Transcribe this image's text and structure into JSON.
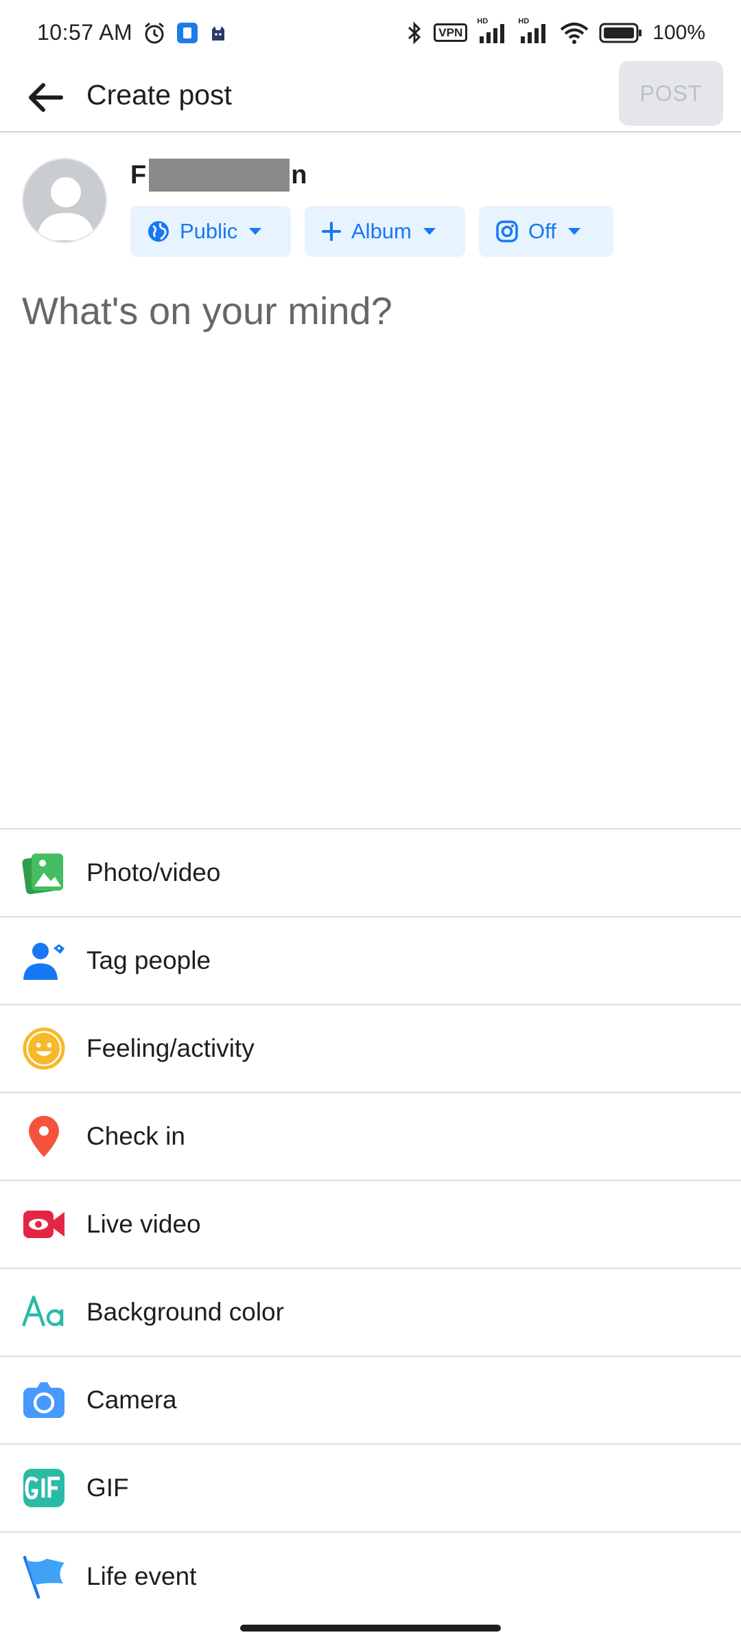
{
  "status_bar": {
    "time": "10:57 AM",
    "vpn": "VPN",
    "hd1": "HD",
    "hd2": "HD",
    "battery_pct": "100%"
  },
  "app_bar": {
    "title": "Create post",
    "post_label": "POST"
  },
  "author": {
    "name_start": "F",
    "name_end": "n"
  },
  "chips": {
    "privacy_label": "Public",
    "album_label": "Album",
    "instagram_label": "Off"
  },
  "composer": {
    "placeholder": "What's on your mind?"
  },
  "actions": [
    {
      "label": "Photo/video",
      "icon": "photo-icon",
      "color": "#45bd62"
    },
    {
      "label": "Tag people",
      "icon": "tag-people-icon",
      "color": "#1877f2"
    },
    {
      "label": "Feeling/activity",
      "icon": "smiley-icon",
      "color": "#f7b928"
    },
    {
      "label": "Check in",
      "icon": "location-pin-icon",
      "color": "#f5533d"
    },
    {
      "label": "Live video",
      "icon": "live-video-icon",
      "color": "#e42645"
    },
    {
      "label": "Background color",
      "icon": "text-aa-icon",
      "color": "#2abba7"
    },
    {
      "label": "Camera",
      "icon": "camera-icon",
      "color": "#4599ff"
    },
    {
      "label": "GIF",
      "icon": "gif-icon",
      "color": "#2abba7"
    },
    {
      "label": "Life event",
      "icon": "flag-icon",
      "color": "#3ea2f7"
    }
  ],
  "colors": {
    "accent": "#1877f2",
    "chip_bg": "#e7f3ff",
    "post_disabled_bg": "#e4e6eb"
  }
}
